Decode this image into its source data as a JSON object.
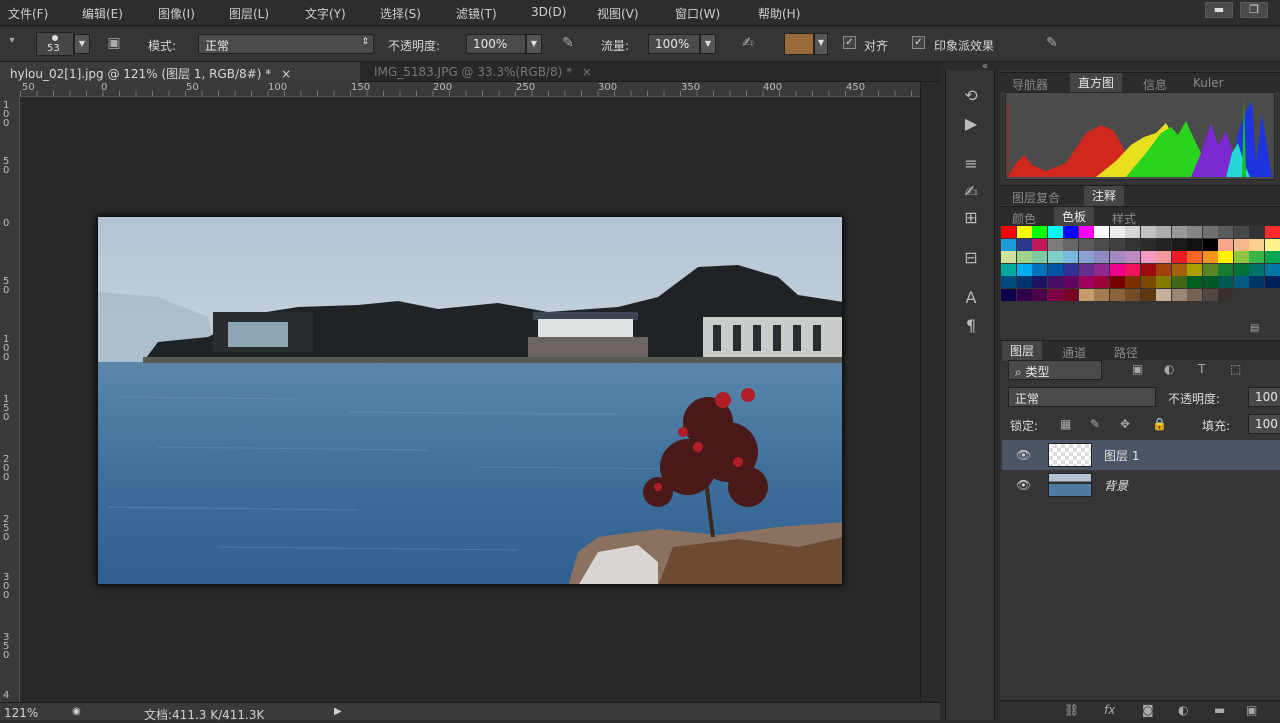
{
  "menubar": {
    "items": [
      "文件(F)",
      "编辑(E)",
      "图像(I)",
      "图层(L)",
      "文字(Y)",
      "选择(S)",
      "滤镜(T)",
      "3D(D)",
      "视图(V)",
      "窗口(W)",
      "帮助(H)"
    ],
    "minimize": "▬",
    "restore": "❐"
  },
  "options": {
    "brush_size": "53",
    "mode_label": "模式:",
    "mode_value": "正常",
    "opacity_label": "不透明度:",
    "opacity_value": "100%",
    "flow_label": "流量:",
    "flow_value": "100%",
    "align_label": "对齐",
    "impressionist_label": "印象派效果",
    "swatch_color": "#9b6a3a"
  },
  "tabs": [
    {
      "label": "hylou_02[1].jpg @ 121% (图层 1, RGB/8#) *",
      "close": "×",
      "active": true
    },
    {
      "label": "IMG_5183.JPG @ 33.3%(RGB/8) *",
      "close": "×",
      "active": false
    }
  ],
  "ruler_h": [
    "50",
    "0",
    "50",
    "100",
    "150",
    "200",
    "250",
    "300",
    "350",
    "400",
    "450"
  ],
  "ruler_v": [
    "100",
    "50",
    "0",
    "50",
    "100",
    "150",
    "200",
    "250",
    "300",
    "350",
    "4"
  ],
  "status": {
    "zoom": "121%",
    "doc": "文档:411.3 K/411.3K",
    "arrow": "▶"
  },
  "panels": {
    "collapse": "«",
    "top_tabs": [
      "导航器",
      "直方图",
      "信息",
      "Kuler"
    ],
    "mid_tabs": [
      "图层复合",
      "注释"
    ],
    "color_tabs": [
      "颜色",
      "色板",
      "样式"
    ],
    "layer_tabs": [
      "图层",
      "通道",
      "路径"
    ],
    "filter_kind": "类型",
    "blend_mode": "正常",
    "opacity_label": "不透明度:",
    "opacity_value": "100",
    "lock_label": "锁定:",
    "fill_label": "填充:",
    "fill_value": "100"
  },
  "layers": [
    {
      "name": "图层 1",
      "visible": true,
      "selected": true
    },
    {
      "name": "背景",
      "visible": true,
      "selected": false
    }
  ],
  "swatch_rows": [
    [
      "#ff0000",
      "#ffff00",
      "#00ff00",
      "#00ffff",
      "#0000ff",
      "#ff00ff",
      "#ffffff",
      "#ebebeb",
      "#d6d6d6",
      "#c2c2c2",
      "#adadad",
      "#999999",
      "#858585",
      "#707070",
      "#5c5c5c",
      "#474747",
      "#333333",
      "#ff2a2a"
    ],
    [
      "#1b9bd7",
      "#2b3990",
      "#c2185b",
      "#7b7b7b",
      "#666666",
      "#5a5a5a",
      "#4d4d4d",
      "#404040",
      "#333333",
      "#2a2a2a",
      "#222222",
      "#1a1a1a",
      "#111111",
      "#000000",
      "#f5a68c",
      "#f7b98c",
      "#fcd08c",
      "#fff28c"
    ],
    [
      "#cde39b",
      "#9fd38e",
      "#7ccba2",
      "#7dd0c8",
      "#7ab8e0",
      "#8aa2d3",
      "#8f8ac4",
      "#a389c0",
      "#bd8cbf",
      "#f49ac1",
      "#f6989d",
      "#ed1c24",
      "#f26522",
      "#f7941d",
      "#fff200",
      "#8dc63f",
      "#39b54a",
      "#00a651"
    ],
    [
      "#00a99d",
      "#00aeef",
      "#0072bc",
      "#0054a6",
      "#2e3192",
      "#662d91",
      "#92278f",
      "#ec008c",
      "#ed145b",
      "#9e0b0f",
      "#a0410d",
      "#a36209",
      "#aba000",
      "#598527",
      "#197b30",
      "#007236",
      "#00746b",
      "#0076a3"
    ],
    [
      "#004a80",
      "#003471",
      "#1b1464",
      "#440e62",
      "#630460",
      "#9e005d",
      "#9e0039",
      "#790000",
      "#7b2e00",
      "#7d4900",
      "#827b00",
      "#406618",
      "#005e20",
      "#005826",
      "#005952",
      "#005b7f",
      "#003663",
      "#002157"
    ],
    [
      "#0d004c",
      "#32004b",
      "#4b0049",
      "#7b0046",
      "#7a0026",
      "#c69c6d",
      "#a67c52",
      "#8c6239",
      "#754c24",
      "#603913",
      "#c7b299",
      "#998675",
      "#736357",
      "#534741",
      "#362f2d"
    ]
  ]
}
